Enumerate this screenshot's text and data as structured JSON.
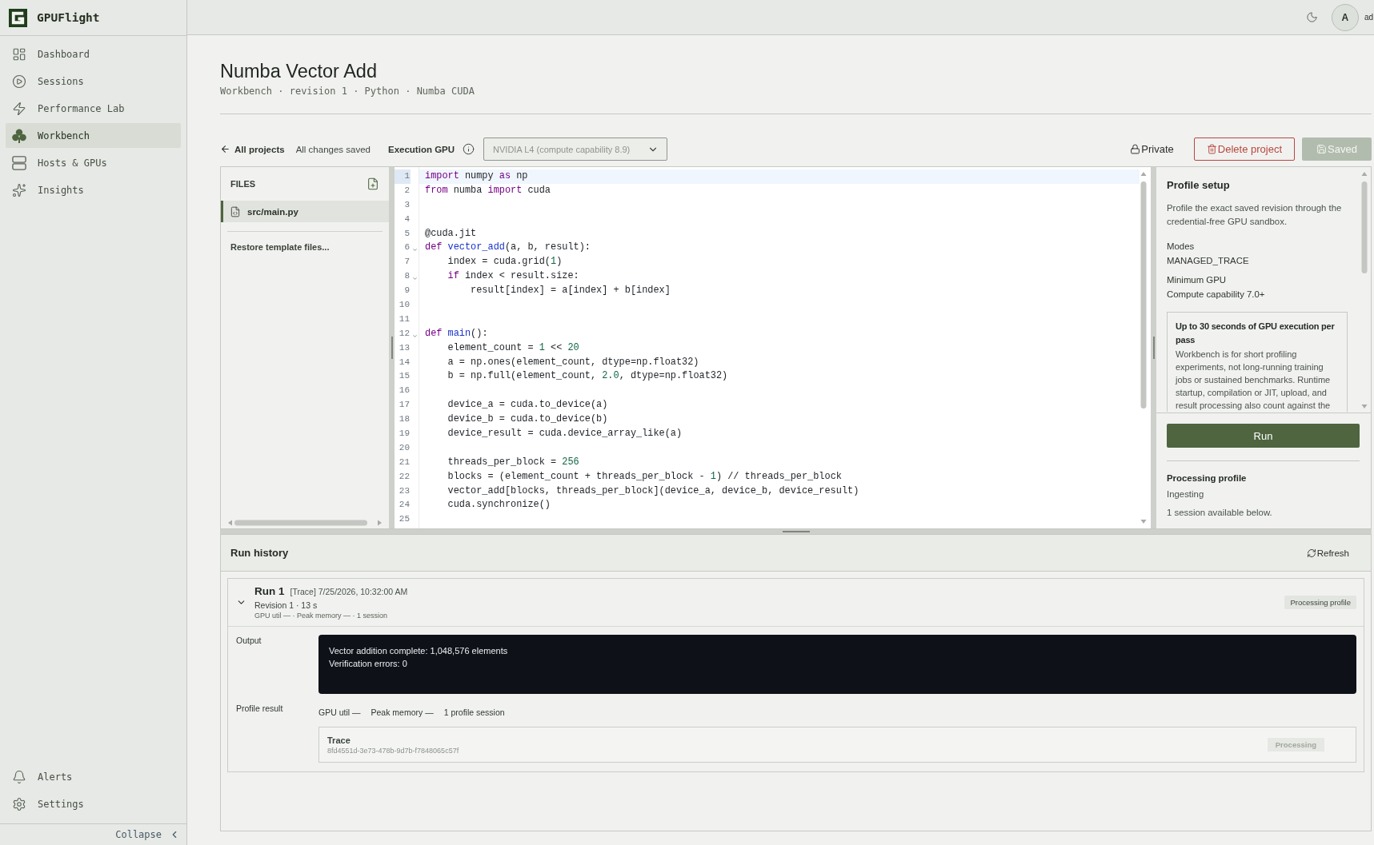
{
  "app": {
    "name": "GPUFlight"
  },
  "sidebar": {
    "items": [
      {
        "label": "Dashboard",
        "selected": false
      },
      {
        "label": "Sessions",
        "selected": false
      },
      {
        "label": "Performance Lab",
        "selected": false
      },
      {
        "label": "Workbench",
        "selected": true
      },
      {
        "label": "Hosts & GPUs",
        "selected": false
      },
      {
        "label": "Insights",
        "selected": false
      }
    ],
    "footer_items": [
      {
        "label": "Alerts",
        "selected": false
      },
      {
        "label": "Settings",
        "selected": false
      }
    ],
    "collapse": "Collapse"
  },
  "topbar": {
    "avatar_initial": "A",
    "user_name": "ad"
  },
  "page": {
    "title": "Numba Vector Add",
    "subtitle": "Workbench · revision 1 · Python · Numba CUDA"
  },
  "toolbar": {
    "back_link": "All projects",
    "save_status": "All changes saved",
    "gpu_label": "Execution GPU",
    "gpu_select": {
      "value": "NVIDIA L4 (compute capability 8.9)",
      "disabled": true
    },
    "visibility": "Private",
    "delete_button": "Delete project",
    "save_button": {
      "label": "Saved",
      "disabled": true
    }
  },
  "files_panel": {
    "title": "FILES",
    "files": [
      {
        "name": "src/main.py",
        "selected": true
      }
    ],
    "restore_link": "Restore template files..."
  },
  "editor": {
    "lines": [
      {
        "number": "1",
        "active": true,
        "foldable": false,
        "tokens": [
          {
            "text": "import",
            "kind": "keyword"
          },
          {
            "text": " numpy ",
            "kind": "plain"
          },
          {
            "text": "as",
            "kind": "keyword"
          },
          {
            "text": " np",
            "kind": "plain"
          }
        ]
      },
      {
        "number": "2",
        "active": false,
        "foldable": false,
        "tokens": [
          {
            "text": "from",
            "kind": "keyword"
          },
          {
            "text": " numba ",
            "kind": "plain"
          },
          {
            "text": "import",
            "kind": "keyword"
          },
          {
            "text": " cuda",
            "kind": "plain"
          }
        ]
      },
      {
        "number": "3",
        "active": false,
        "foldable": false
      },
      {
        "number": "4",
        "active": false,
        "foldable": false
      },
      {
        "number": "5",
        "active": false,
        "foldable": false,
        "tokens": [
          {
            "text": "@cuda.jit",
            "kind": "plain"
          }
        ]
      },
      {
        "number": "6",
        "active": false,
        "foldable": true,
        "tokens": [
          {
            "text": "def",
            "kind": "keyword"
          },
          {
            "text": " vector_add",
            "kind": "definition"
          },
          {
            "text": "(a, b, result):",
            "kind": "plain"
          }
        ]
      },
      {
        "number": "7",
        "active": false,
        "foldable": false,
        "tokens": [
          {
            "text": "    index = cuda.grid(",
            "kind": "plain"
          },
          {
            "text": "1",
            "kind": "number"
          },
          {
            "text": ")",
            "kind": "plain"
          }
        ]
      },
      {
        "number": "8",
        "active": false,
        "foldable": true,
        "tokens": [
          {
            "text": "    if",
            "kind": "keyword"
          },
          {
            "text": " index < result.size:",
            "kind": "plain"
          }
        ]
      },
      {
        "number": "9",
        "active": false,
        "foldable": false,
        "tokens": [
          {
            "text": "        result[index] = a[index] + b[index]",
            "kind": "plain"
          }
        ]
      },
      {
        "number": "10",
        "active": false,
        "foldable": false
      },
      {
        "number": "11",
        "active": false,
        "foldable": false
      },
      {
        "number": "12",
        "active": false,
        "foldable": true,
        "tokens": [
          {
            "text": "def",
            "kind": "keyword"
          },
          {
            "text": " main",
            "kind": "definition"
          },
          {
            "text": "():",
            "kind": "plain"
          }
        ]
      },
      {
        "number": "13",
        "active": false,
        "foldable": false,
        "tokens": [
          {
            "text": "    element_count = ",
            "kind": "plain"
          },
          {
            "text": "1",
            "kind": "number"
          },
          {
            "text": " << ",
            "kind": "plain"
          },
          {
            "text": "20",
            "kind": "number"
          }
        ]
      },
      {
        "number": "14",
        "active": false,
        "foldable": false,
        "tokens": [
          {
            "text": "    a = np.ones(element_count, dtype=np.float32)",
            "kind": "plain"
          }
        ]
      },
      {
        "number": "15",
        "active": false,
        "foldable": false,
        "tokens": [
          {
            "text": "    b = np.full(element_count, ",
            "kind": "plain"
          },
          {
            "text": "2.0",
            "kind": "number"
          },
          {
            "text": ", dtype=np.float32)",
            "kind": "plain"
          }
        ]
      },
      {
        "number": "16",
        "active": false,
        "foldable": false
      },
      {
        "number": "17",
        "active": false,
        "foldable": false,
        "tokens": [
          {
            "text": "    device_a = cuda.to_device(a)",
            "kind": "plain"
          }
        ]
      },
      {
        "number": "18",
        "active": false,
        "foldable": false,
        "tokens": [
          {
            "text": "    device_b = cuda.to_device(b)",
            "kind": "plain"
          }
        ]
      },
      {
        "number": "19",
        "active": false,
        "foldable": false,
        "tokens": [
          {
            "text": "    device_result = cuda.device_array_like(a)",
            "kind": "plain"
          }
        ]
      },
      {
        "number": "20",
        "active": false,
        "foldable": false
      },
      {
        "number": "21",
        "active": false,
        "foldable": false,
        "tokens": [
          {
            "text": "    threads_per_block = ",
            "kind": "plain"
          },
          {
            "text": "256",
            "kind": "number"
          }
        ]
      },
      {
        "number": "22",
        "active": false,
        "foldable": false,
        "tokens": [
          {
            "text": "    blocks = (element_count + threads_per_block - ",
            "kind": "plain"
          },
          {
            "text": "1",
            "kind": "number"
          },
          {
            "text": ") // threads_per_block",
            "kind": "plain"
          }
        ]
      },
      {
        "number": "23",
        "active": false,
        "foldable": false,
        "tokens": [
          {
            "text": "    vector_add[blocks, threads_per_block](device_a, device_b, device_result)",
            "kind": "plain"
          }
        ]
      },
      {
        "number": "24",
        "active": false,
        "foldable": false,
        "tokens": [
          {
            "text": "    cuda.synchronize()",
            "kind": "plain"
          }
        ]
      },
      {
        "number": "25",
        "active": false,
        "foldable": false
      }
    ]
  },
  "profile_panel": {
    "title": "Profile setup",
    "description": "Profile the exact saved revision through the credential-free GPU sandbox.",
    "fields": [
      {
        "label": "Modes",
        "value": "MANAGED_TRACE"
      },
      {
        "label": "Minimum GPU",
        "value": "Compute capability 7.0+"
      }
    ],
    "notice": {
      "title": "Up to 30 seconds of GPU execution per pass",
      "text": "Workbench is for short profiling experiments, not long-running training jobs or sustained benchmarks. Runtime startup, compilation or JIT, upload, and result processing also count against the"
    },
    "run_button": "Run",
    "status": {
      "title": "Processing profile",
      "state": "Ingesting",
      "detail": "1 session available below."
    }
  },
  "run_history": {
    "title": "Run history",
    "refresh": "Refresh",
    "runs": [
      {
        "title": "Run 1",
        "meta": "[Trace] 7/25/2026, 10:32:00 AM",
        "revision": "Revision 1 · 13 s",
        "stats": "GPU util — · Peak memory — · 1 session",
        "status": "Processing profile",
        "expanded": true,
        "output_label": "Output",
        "output": [
          "Vector addition complete: 1,048,576 elements",
          "Verification errors: 0"
        ],
        "profile_label": "Profile result",
        "profile_stats": [
          "GPU util —",
          "Peak memory —",
          "1 profile session"
        ],
        "sessions": [
          {
            "title": "Trace",
            "id": "8fd4551d-3e73-478b-9d7b-f7848065c57f",
            "status": "Processing"
          }
        ]
      }
    ]
  }
}
